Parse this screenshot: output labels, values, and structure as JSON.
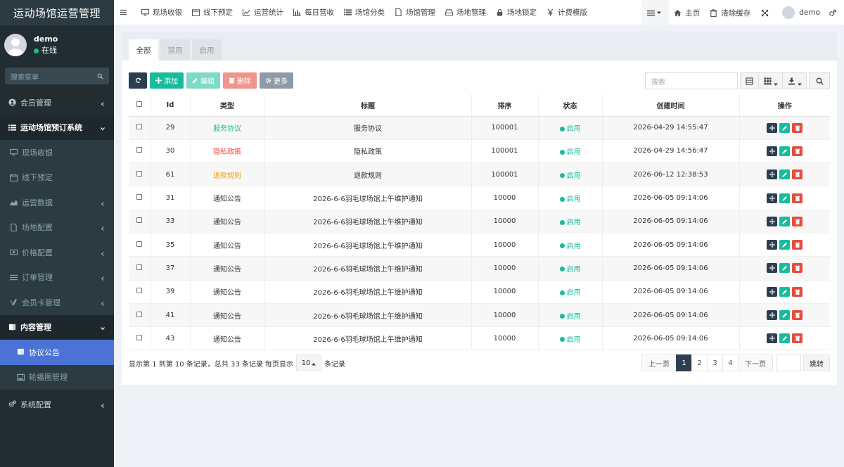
{
  "app": {
    "title": "运动场馆运营管理"
  },
  "user": {
    "name": "demo",
    "status": "在线"
  },
  "sidebar": {
    "search_placeholder": "搜索菜单",
    "items": [
      {
        "label": "会员管理"
      },
      {
        "label": "运动场馆预订系统"
      },
      {
        "label": "现场收银"
      },
      {
        "label": "线下预定"
      },
      {
        "label": "运营数据"
      },
      {
        "label": "场地配置"
      },
      {
        "label": "价格配置"
      },
      {
        "label": "订单管理"
      },
      {
        "label": "会员卡管理"
      },
      {
        "label": "内容管理"
      },
      {
        "label": "协议公告"
      },
      {
        "label": "轮播图管理"
      },
      {
        "label": "系统配置"
      }
    ]
  },
  "topnav": {
    "items": [
      "现场收银",
      "线下预定",
      "运营统计",
      "每日营收",
      "场馆分类",
      "场馆管理",
      "场地管理",
      "场地锁定",
      "计费模版"
    ],
    "home": "主页",
    "clear_cache": "清除缓存",
    "user": "demo"
  },
  "tabs": [
    "全部",
    "禁用",
    "启用"
  ],
  "toolbar": {
    "add": "添加",
    "edit": "编辑",
    "delete": "删除",
    "more": "更多"
  },
  "search": {
    "placeholder": "搜索"
  },
  "table": {
    "headers": [
      "Id",
      "类型",
      "标题",
      "排序",
      "状态",
      "创建时间",
      "操作"
    ],
    "rows": [
      {
        "id": "29",
        "type": "服务协议",
        "type_color": "#18bc9c",
        "title": "服务协议",
        "weigh": "100001",
        "status": "启用",
        "time": "2026-04-29 14:55:47"
      },
      {
        "id": "30",
        "type": "隐私政策",
        "type_color": "#e74c3c",
        "title": "隐私政策",
        "weigh": "100001",
        "status": "启用",
        "time": "2026-04-29 14:56:47"
      },
      {
        "id": "61",
        "type": "退款规则",
        "type_color": "#f39c12",
        "title": "退款规则",
        "weigh": "100001",
        "status": "启用",
        "time": "2026-06-12 12:38:53"
      },
      {
        "id": "31",
        "type": "通知公告",
        "type_color": "#333333",
        "title": "2026-6-6羽毛球场馆上午维护通知",
        "weigh": "10000",
        "status": "启用",
        "time": "2026-06-05 09:14:06"
      },
      {
        "id": "33",
        "type": "通知公告",
        "type_color": "#333333",
        "title": "2026-6-6羽毛球场馆上午维护通知",
        "weigh": "10000",
        "status": "启用",
        "time": "2026-06-05 09:14:06"
      },
      {
        "id": "35",
        "type": "通知公告",
        "type_color": "#333333",
        "title": "2026-6-6羽毛球场馆上午维护通知",
        "weigh": "10000",
        "status": "启用",
        "time": "2026-06-05 09:14:06"
      },
      {
        "id": "37",
        "type": "通知公告",
        "type_color": "#333333",
        "title": "2026-6-6羽毛球场馆上午维护通知",
        "weigh": "10000",
        "status": "启用",
        "time": "2026-06-05 09:14:06"
      },
      {
        "id": "39",
        "type": "通知公告",
        "type_color": "#333333",
        "title": "2026-6-6羽毛球场馆上午维护通知",
        "weigh": "10000",
        "status": "启用",
        "time": "2026-06-05 09:14:06"
      },
      {
        "id": "41",
        "type": "通知公告",
        "type_color": "#333333",
        "title": "2026-6-6羽毛球场馆上午维护通知",
        "weigh": "10000",
        "status": "启用",
        "time": "2026-06-05 09:14:06"
      },
      {
        "id": "43",
        "type": "通知公告",
        "type_color": "#333333",
        "title": "2026-6-6羽毛球场馆上午维护通知",
        "weigh": "10000",
        "status": "启用",
        "time": "2026-06-05 09:14:06"
      }
    ]
  },
  "footer": {
    "info": "显示第 1 到第 10 条记录，总共 33 条记录 每页显示",
    "page_size": "10",
    "suffix": "条记录"
  },
  "pager": {
    "prev": "上一页",
    "pages": [
      "1",
      "2",
      "3",
      "4"
    ],
    "next": "下一页",
    "jump": "跳转"
  },
  "colors": {
    "sidebar": "#222d32",
    "active": "#4b73d6",
    "accent": "#18bc9c",
    "dark": "#2c3e50",
    "danger": "#e74c3c"
  },
  "icons": {
    "sidebar": [
      "user-circle-icon",
      "list-icon",
      "monitor-icon",
      "calendar-icon",
      "area-chart-icon",
      "file-icon",
      "money-icon",
      "list-icon",
      "vimeo-icon",
      "book-icon",
      "book-icon",
      "image-icon",
      "gears-icon"
    ],
    "topnav": [
      "monitor-icon",
      "calendar-icon",
      "line-chart-icon",
      "bar-chart-icon",
      "list-icon",
      "file-icon",
      "drive-icon",
      "lock-icon",
      "yen-icon"
    ]
  }
}
